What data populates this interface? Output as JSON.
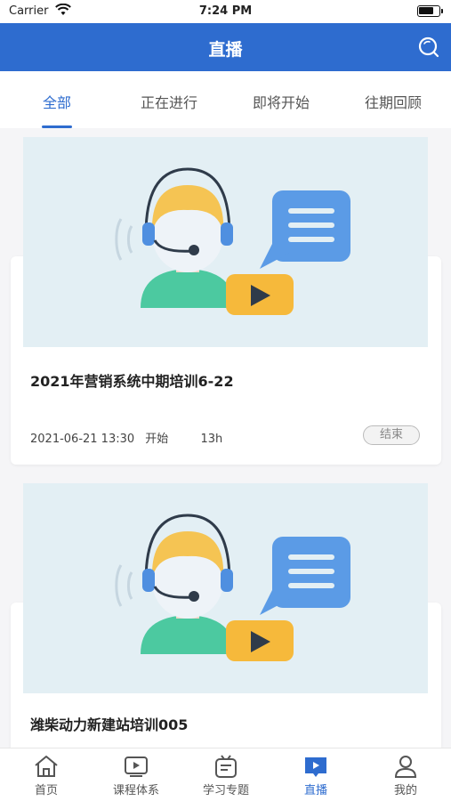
{
  "status_bar": {
    "carrier": "Carrier",
    "time": "7:24 PM"
  },
  "header": {
    "title": "直播"
  },
  "tabs": [
    {
      "label": "全部"
    },
    {
      "label": "正在进行"
    },
    {
      "label": "即将开始"
    },
    {
      "label": "往期回顾"
    }
  ],
  "live_list": [
    {
      "title": "2021年营销系统中期培训6-22",
      "date": "2021-06-21 13:30",
      "start_label": "开始",
      "duration": "13h",
      "status": "结束"
    },
    {
      "title": "潍柴动力新建站培训005"
    }
  ],
  "bottom_nav": [
    {
      "label": "首页"
    },
    {
      "label": "课程体系"
    },
    {
      "label": "学习专题"
    },
    {
      "label": "直播"
    },
    {
      "label": "我的"
    }
  ],
  "colors": {
    "primary": "#2e6ccf",
    "banner_bg": "#e3eff4",
    "hair": "#f5c453",
    "shirt": "#4cc9a0",
    "bubble": "#5b9be6",
    "play": "#f6b93b"
  }
}
